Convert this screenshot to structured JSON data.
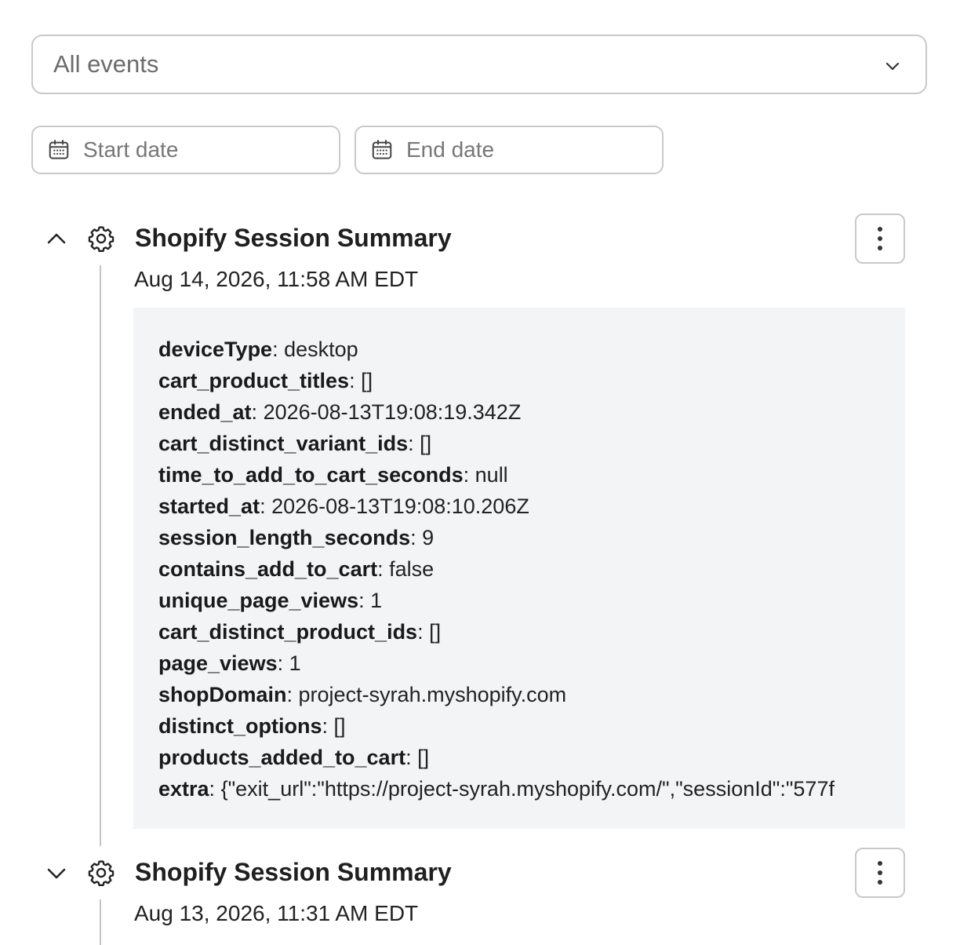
{
  "filter": {
    "selected": "All events"
  },
  "dates": {
    "start_placeholder": "Start date",
    "end_placeholder": "End date"
  },
  "events": [
    {
      "title": "Shopify Session Summary",
      "timestamp": "Aug 14, 2026, 11:58 AM EDT",
      "expanded": true,
      "properties": [
        {
          "key": "deviceType",
          "value": "desktop"
        },
        {
          "key": "cart_product_titles",
          "value": "[]"
        },
        {
          "key": "ended_at",
          "value": "2026-08-13T19:08:19.342Z"
        },
        {
          "key": "cart_distinct_variant_ids",
          "value": "[]"
        },
        {
          "key": "time_to_add_to_cart_seconds",
          "value": "null"
        },
        {
          "key": "started_at",
          "value": "2026-08-13T19:08:10.206Z"
        },
        {
          "key": "session_length_seconds",
          "value": "9"
        },
        {
          "key": "contains_add_to_cart",
          "value": "false"
        },
        {
          "key": "unique_page_views",
          "value": "1"
        },
        {
          "key": "cart_distinct_product_ids",
          "value": "[]"
        },
        {
          "key": "page_views",
          "value": "1"
        },
        {
          "key": "shopDomain",
          "value": "project-syrah.myshopify.com"
        },
        {
          "key": "distinct_options",
          "value": "[]"
        },
        {
          "key": "products_added_to_cart",
          "value": "[]"
        },
        {
          "key": "extra",
          "value": "{\"exit_url\":\"https://project-syrah.myshopify.com/\",\"sessionId\":\"577f"
        }
      ]
    },
    {
      "title": "Shopify Session Summary",
      "timestamp": "Aug 13, 2026, 11:31 AM EDT",
      "expanded": false
    }
  ],
  "icons": {
    "dropdown": "chevron-down-icon",
    "date": "calendar-icon",
    "collapse": "chevron-up-icon",
    "expand": "chevron-down-icon",
    "event_type": "gear-icon",
    "menu": "more-vertical-icon"
  }
}
